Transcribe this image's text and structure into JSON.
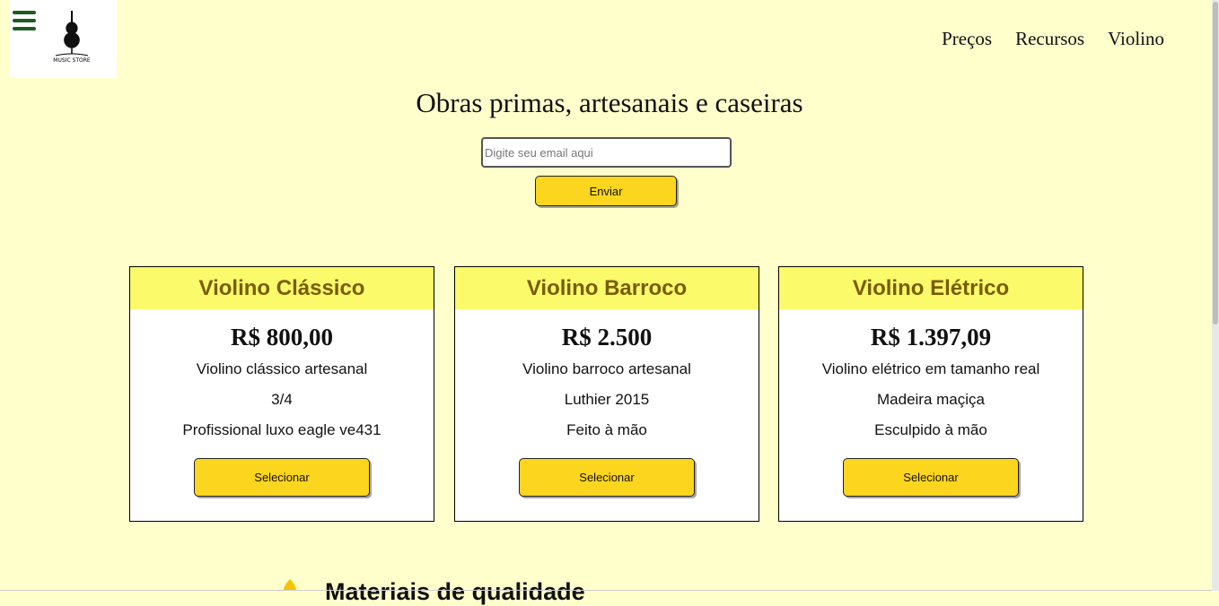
{
  "header": {
    "nav": [
      {
        "label": "Preços"
      },
      {
        "label": "Recursos"
      },
      {
        "label": "Violino"
      }
    ],
    "menu_icon": "hamburger-icon",
    "logo_text": "MUSIC STORE"
  },
  "hero": {
    "title": "Obras primas, artesanais e caseiras",
    "email_placeholder": "Digite seu email aqui",
    "submit_label": "Enviar"
  },
  "cards": [
    {
      "title": "Violino Clássico",
      "price": "R$ 800,00",
      "features": [
        "Violino clássico artesanal",
        "3/4",
        "Profissional luxo eagle ve431"
      ],
      "button": "Selecionar"
    },
    {
      "title": "Violino Barroco",
      "price": "R$ 2.500",
      "features": [
        "Violino barroco artesanal",
        "Luthier 2015",
        "Feito à mão"
      ],
      "button": "Selecionar"
    },
    {
      "title": "Violino Elétrico",
      "price": "R$ 1.397,09",
      "features": [
        "Violino elétrico em tamanho real",
        "Madeira maçiça",
        "Esculpido à mão"
      ],
      "button": "Selecionar"
    }
  ],
  "section": {
    "heading": "Materiais de qualidade"
  },
  "colors": {
    "background": "#ffffcc",
    "card_header": "#fafa6b",
    "card_title": "#7a5c00",
    "button": "#fcd51e",
    "menu_icon": "#1b5e20"
  }
}
